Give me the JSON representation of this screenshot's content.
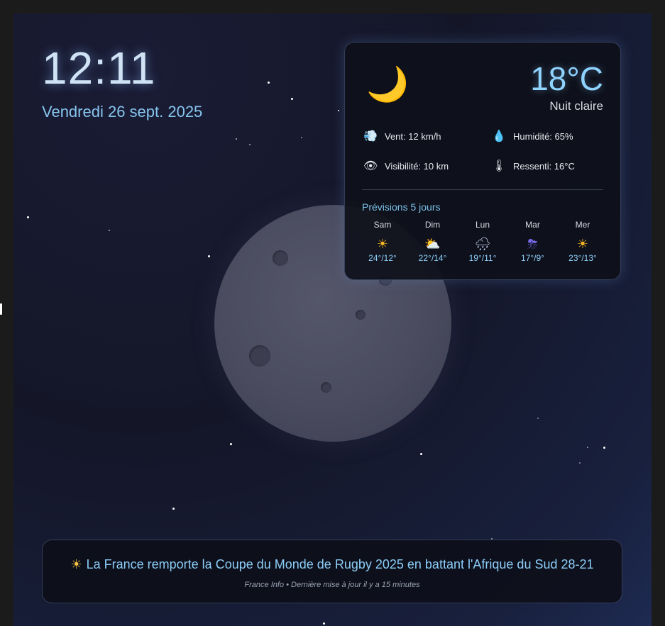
{
  "clock": {
    "time": "12:11",
    "date": "Vendredi 26 sept. 2025"
  },
  "weather": {
    "icon": "crescent-moon-icon",
    "icon_glyph": "🌙",
    "temperature": "18°C",
    "condition": "Nuit claire",
    "details": [
      {
        "icon": "wind-icon",
        "glyph": "💨",
        "label": "Vent: 12 km/h"
      },
      {
        "icon": "droplet-icon",
        "glyph": "💧",
        "label": "Humidité: 65%"
      },
      {
        "icon": "eye-icon",
        "glyph": "👁",
        "label": "Visibilité: 10 km"
      },
      {
        "icon": "thermometer-icon",
        "glyph": "🌡",
        "label": "Ressenti: 16°C"
      }
    ],
    "forecast_title": "Prévisions 5 jours",
    "forecast": [
      {
        "day": "Sam",
        "icon": "sun-icon",
        "glyph": "☀",
        "temps": "24°/12°"
      },
      {
        "day": "Dim",
        "icon": "partly-cloudy-icon",
        "glyph": "⛅",
        "temps": "22°/14°"
      },
      {
        "day": "Lun",
        "icon": "rain-cloud-icon",
        "glyph": "🌧",
        "temps": "19°/11°"
      },
      {
        "day": "Mar",
        "icon": "thunderstorm-icon",
        "glyph": "⛈",
        "temps": "17°/9°"
      },
      {
        "day": "Mer",
        "icon": "sun-icon",
        "glyph": "☀",
        "temps": "23°/13°"
      }
    ]
  },
  "news": {
    "icon": "sun-icon",
    "icon_glyph": "☀",
    "headline": "La France remporte la Coupe du Monde de Rugby 2025 en battant l'Afrique du Sud 28-21",
    "meta": "France Info • Dernière mise à jour il y a 15 minutes"
  },
  "colors": {
    "accent": "#8fd3ff",
    "date": "#87c6ef",
    "background": "#141628"
  }
}
